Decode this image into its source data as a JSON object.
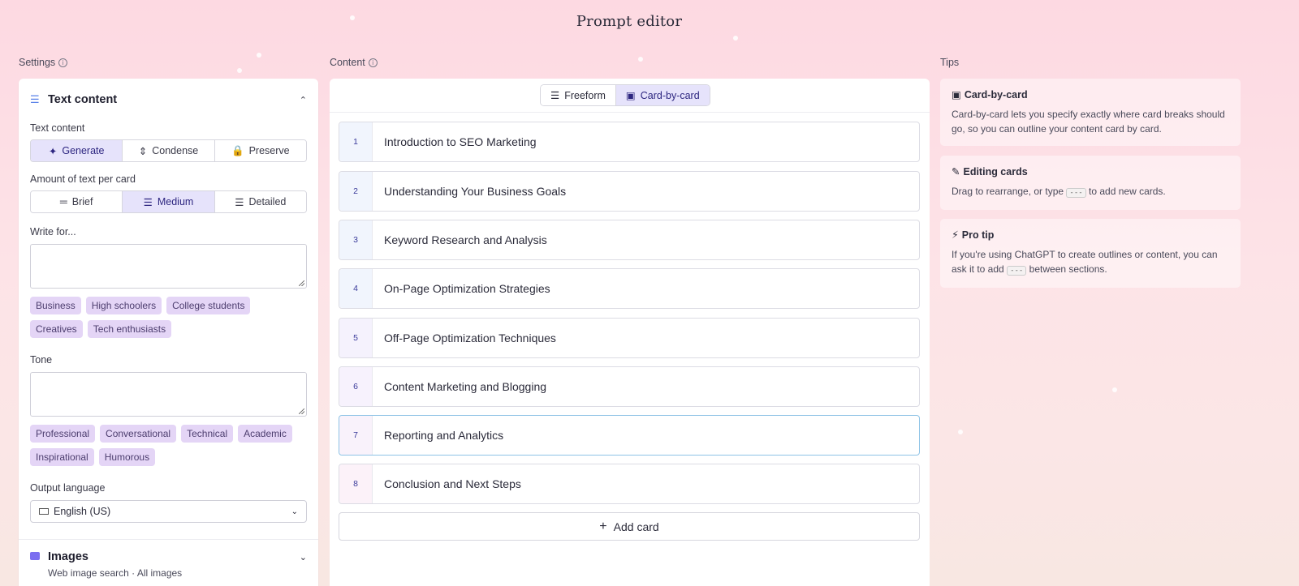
{
  "page": {
    "title": "Prompt editor"
  },
  "columns": {
    "settings": "Settings",
    "content": "Content",
    "tips": "Tips"
  },
  "settings": {
    "text_section": {
      "title": "Text content",
      "text_content_label": "Text content",
      "modes": [
        "Generate",
        "Condense",
        "Preserve"
      ],
      "amount_label": "Amount of text per card",
      "amounts": [
        "Brief",
        "Medium",
        "Detailed"
      ],
      "write_for_label": "Write for...",
      "audience_chips": [
        "Business",
        "High schoolers",
        "College students",
        "Creatives",
        "Tech enthusiasts"
      ],
      "tone_label": "Tone",
      "tone_chips": [
        "Professional",
        "Conversational",
        "Technical",
        "Academic",
        "Inspirational",
        "Humorous"
      ],
      "language_label": "Output language",
      "language_value": "English (US)"
    },
    "images_section": {
      "title": "Images",
      "subtitle": "Web image search · All images"
    }
  },
  "content": {
    "toggle": {
      "freeform": "Freeform",
      "card_by_card": "Card-by-card"
    },
    "cards": [
      {
        "n": "1",
        "label": "Introduction to SEO Marketing"
      },
      {
        "n": "2",
        "label": "Understanding Your Business Goals"
      },
      {
        "n": "3",
        "label": "Keyword Research and Analysis"
      },
      {
        "n": "4",
        "label": "On-Page Optimization Strategies"
      },
      {
        "n": "5",
        "label": "Off-Page Optimization Techniques"
      },
      {
        "n": "6",
        "label": "Content Marketing and Blogging"
      },
      {
        "n": "7",
        "label": "Reporting and Analytics"
      },
      {
        "n": "8",
        "label": "Conclusion and Next Steps"
      }
    ],
    "add_card": "Add card"
  },
  "tips": {
    "card_by_card": {
      "title": "Card-by-card",
      "body": "Card-by-card lets you specify exactly where card breaks should go, so you can outline your content card by card."
    },
    "editing": {
      "title": "Editing cards",
      "body_a": "Drag to rearrange, or type",
      "code": "---",
      "body_b": "to add new cards."
    },
    "pro": {
      "title": "Pro tip",
      "body_a": "If you're using ChatGPT to create outlines or content, you can ask it to add",
      "code": "---",
      "body_b": "between sections."
    }
  },
  "colors": {
    "accent": "#e6e3fb",
    "chip": "#e4d5f6",
    "selected_border": "#8ec3e6"
  }
}
